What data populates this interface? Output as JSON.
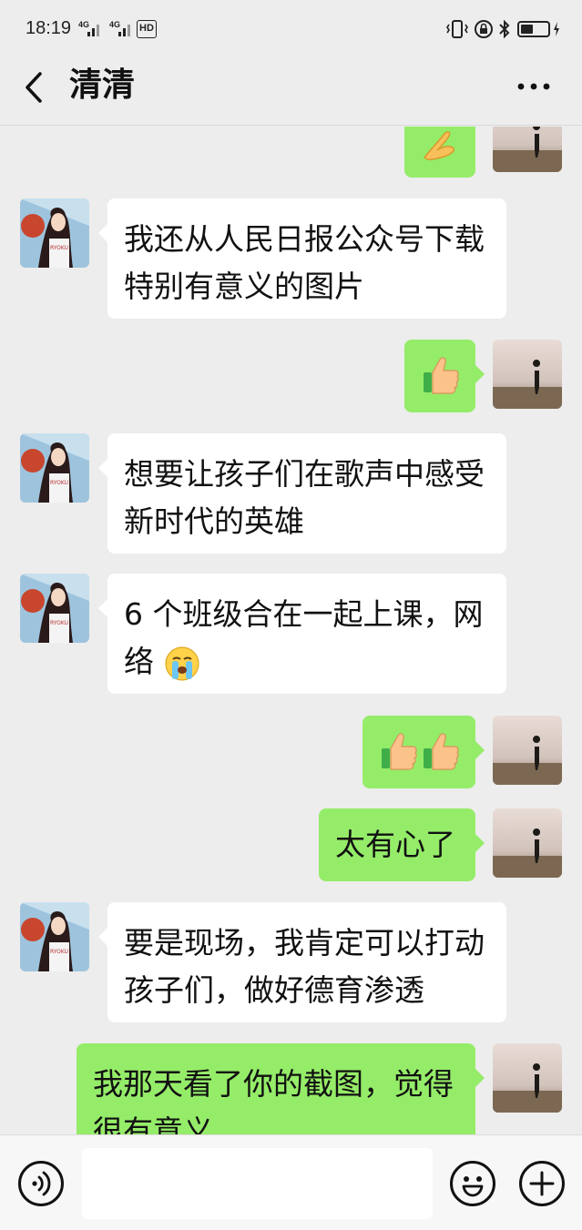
{
  "status_bar": {
    "time": "18:19",
    "signal_1": "4G",
    "signal_2": "4G",
    "hd_label": "HD"
  },
  "nav": {
    "title": "清清",
    "back_icon": "chevron-left-icon",
    "more_icon": "more-horizontal-icon"
  },
  "messages": [
    {
      "side": "right",
      "emoji": [
        "pray-emoji"
      ]
    },
    {
      "side": "left",
      "lines": [
        "我还从人民日报公众号下载",
        "特别有意义的图片"
      ]
    },
    {
      "side": "right",
      "emoji": [
        "thumbs-up-emoji"
      ]
    },
    {
      "side": "left",
      "lines": [
        "想要让孩子们在歌声中感受",
        "新时代的英雄"
      ]
    },
    {
      "side": "left",
      "lines": [
        "6 个班级合在一起上课，网",
        "络"
      ],
      "trailing_emoji": "crying-emoji"
    },
    {
      "side": "right",
      "emoji": [
        "thumbs-up-emoji",
        "thumbs-up-emoji"
      ]
    },
    {
      "side": "right",
      "lines": [
        "太有心了"
      ]
    },
    {
      "side": "left",
      "lines": [
        "要是现场，我肯定可以打动",
        "孩子们，做好德育渗透"
      ]
    },
    {
      "side": "right",
      "lines": [
        "我那天看了你的截图，觉得",
        "很有意义"
      ]
    }
  ],
  "input_bar": {
    "voice_icon": "voice-icon",
    "emoji_icon": "smiley-icon",
    "add_icon": "plus-icon",
    "input_value": ""
  },
  "colors": {
    "background": "#ededed",
    "sent_bubble": "#95ec69",
    "received_bubble": "#ffffff"
  }
}
